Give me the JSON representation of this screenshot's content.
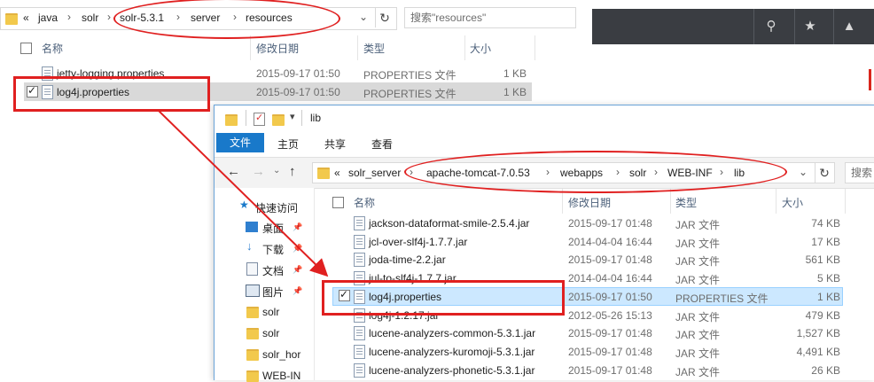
{
  "window1": {
    "breadcrumb": [
      "«",
      "java",
      "solr",
      "solr-5.3.1",
      "server",
      "resources"
    ],
    "search_placeholder": "搜索\"resources\"",
    "columns": {
      "name": "名称",
      "modified": "修改日期",
      "type": "类型",
      "size": "大小"
    },
    "rows": [
      {
        "name": "jetty-logging.properties",
        "modified": "2015-09-17 01:50",
        "type": "PROPERTIES 文件",
        "size": "1 KB",
        "checked": false
      },
      {
        "name": "log4j.properties",
        "modified": "2015-09-17 01:50",
        "type": "PROPERTIES 文件",
        "size": "1 KB",
        "checked": true
      }
    ]
  },
  "window2": {
    "title": "lib",
    "ribbon_tabs": {
      "file": "文件",
      "home": "主页",
      "share": "共享",
      "view": "查看"
    },
    "breadcrumb": [
      "«",
      "solr_server",
      "apache-tomcat-7.0.53",
      "webapps",
      "solr",
      "WEB-INF",
      "lib"
    ],
    "search_label": "搜索",
    "columns": {
      "name": "名称",
      "modified": "修改日期",
      "type": "类型",
      "size": "大小"
    },
    "nav_items": [
      "快速访问",
      "桌面",
      "下载",
      "文档",
      "图片",
      "solr",
      "solr",
      "solr_hor",
      "WEB-IN"
    ],
    "rows": [
      {
        "name": "jackson-dataformat-smile-2.5.4.jar",
        "modified": "2015-09-17 01:48",
        "type": "JAR 文件",
        "size": "74 KB"
      },
      {
        "name": "jcl-over-slf4j-1.7.7.jar",
        "modified": "2014-04-04 16:44",
        "type": "JAR 文件",
        "size": "17 KB"
      },
      {
        "name": "joda-time-2.2.jar",
        "modified": "2015-09-17 01:48",
        "type": "JAR 文件",
        "size": "561 KB"
      },
      {
        "name": "jul-to-slf4j-1.7.7.jar",
        "modified": "2014-04-04 16:44",
        "type": "JAR 文件",
        "size": "5 KB"
      },
      {
        "name": "log4j.properties",
        "modified": "2015-09-17 01:50",
        "type": "PROPERTIES 文件",
        "size": "1 KB"
      },
      {
        "name": "log4j-1.2.17.jar",
        "modified": "2012-05-26 15:13",
        "type": "JAR 文件",
        "size": "479 KB"
      },
      {
        "name": "lucene-analyzers-common-5.3.1.jar",
        "modified": "2015-09-17 01:48",
        "type": "JAR 文件",
        "size": "1,527 KB"
      },
      {
        "name": "lucene-analyzers-kuromoji-5.3.1.jar",
        "modified": "2015-09-17 01:48",
        "type": "JAR 文件",
        "size": "4,491 KB"
      },
      {
        "name": "lucene-analyzers-phonetic-5.3.1.jar",
        "modified": "2015-09-17 01:48",
        "type": "JAR 文件",
        "size": "26 KB"
      }
    ]
  },
  "colors": {
    "annotation_red": "#e02020",
    "ribbon_blue": "#1979ca",
    "selection_blue": "#cce8ff"
  }
}
